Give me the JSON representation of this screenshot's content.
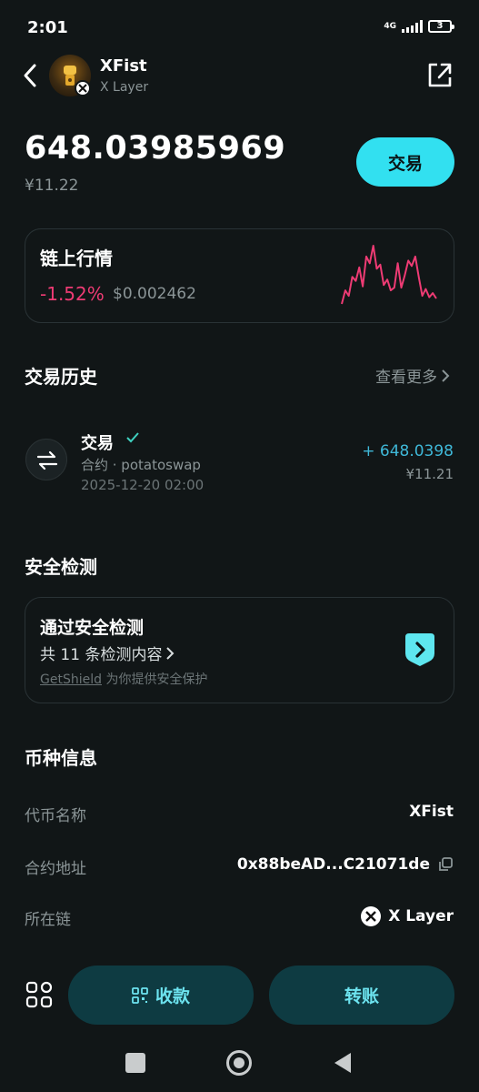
{
  "status_bar": {
    "time": "2:01",
    "network": "4G",
    "battery": "3"
  },
  "header": {
    "token_name": "XFist",
    "chain": "X Layer",
    "back_icon": "chevron-left-icon",
    "share_icon": "external-link-icon"
  },
  "balance": {
    "amount": "648.03985969",
    "fiat": "¥11.22",
    "trade_label": "交易"
  },
  "market": {
    "title": "链上行情",
    "change": "-1.52%",
    "price": "$0.002462",
    "change_color": "#ee3b74",
    "sparkline": [
      10,
      30,
      22,
      50,
      44,
      64,
      36,
      80,
      70,
      96,
      62,
      68,
      38,
      46,
      30,
      34,
      70,
      34,
      52,
      74,
      66,
      80,
      50,
      22,
      32,
      20,
      26,
      18
    ]
  },
  "history": {
    "title": "交易历史",
    "more_label": "查看更多",
    "items": [
      {
        "title": "交易",
        "contract": "合约 · potatoswap",
        "date": "2025-12-20 02:00",
        "amount": "+ 648.0398",
        "fiat": "¥11.21"
      }
    ]
  },
  "security": {
    "title": "安全检测",
    "card_title": "通过安全检测",
    "count_text": "共 11 条检测内容",
    "provider": "GetShield",
    "provider_suffix": " 为你提供安全保护"
  },
  "coin_info": {
    "title": "币种信息",
    "rows": [
      {
        "label": "代币名称",
        "value": "XFist"
      },
      {
        "label": "合约地址",
        "value": "0x88beAD...C21071de"
      },
      {
        "label": "所在链",
        "value": "X Layer"
      }
    ]
  },
  "actions": {
    "receive_label": "收款",
    "send_label": "转账"
  },
  "colors": {
    "accent": "#32e0f0",
    "pill_bg": "#0e3b42",
    "pill_text": "#6de4f0",
    "negative": "#ee3b74",
    "positive_amount": "#3fb8d8",
    "background": "#111617"
  }
}
